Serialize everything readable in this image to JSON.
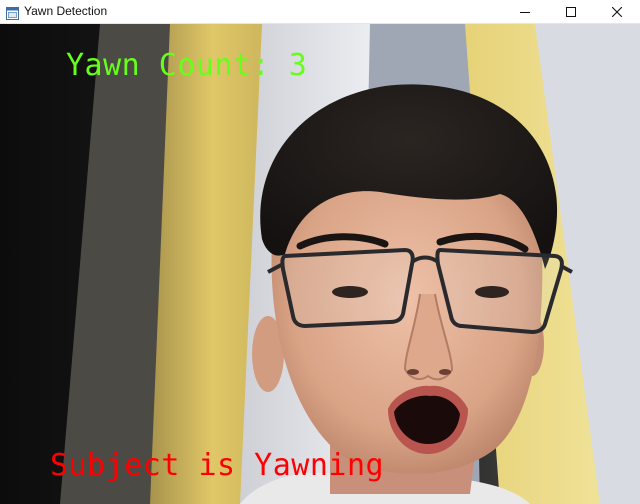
{
  "window": {
    "title": "Yawn Detection",
    "icon": "app-window-icon",
    "controls": [
      "minimize-icon",
      "maximize-icon",
      "close-icon"
    ]
  },
  "overlay": {
    "yawn_count": "Yawn Count: 3",
    "yawn_count_color": "#66ff1a",
    "status": "Subject is Yawning",
    "status_color": "#ff0000"
  }
}
